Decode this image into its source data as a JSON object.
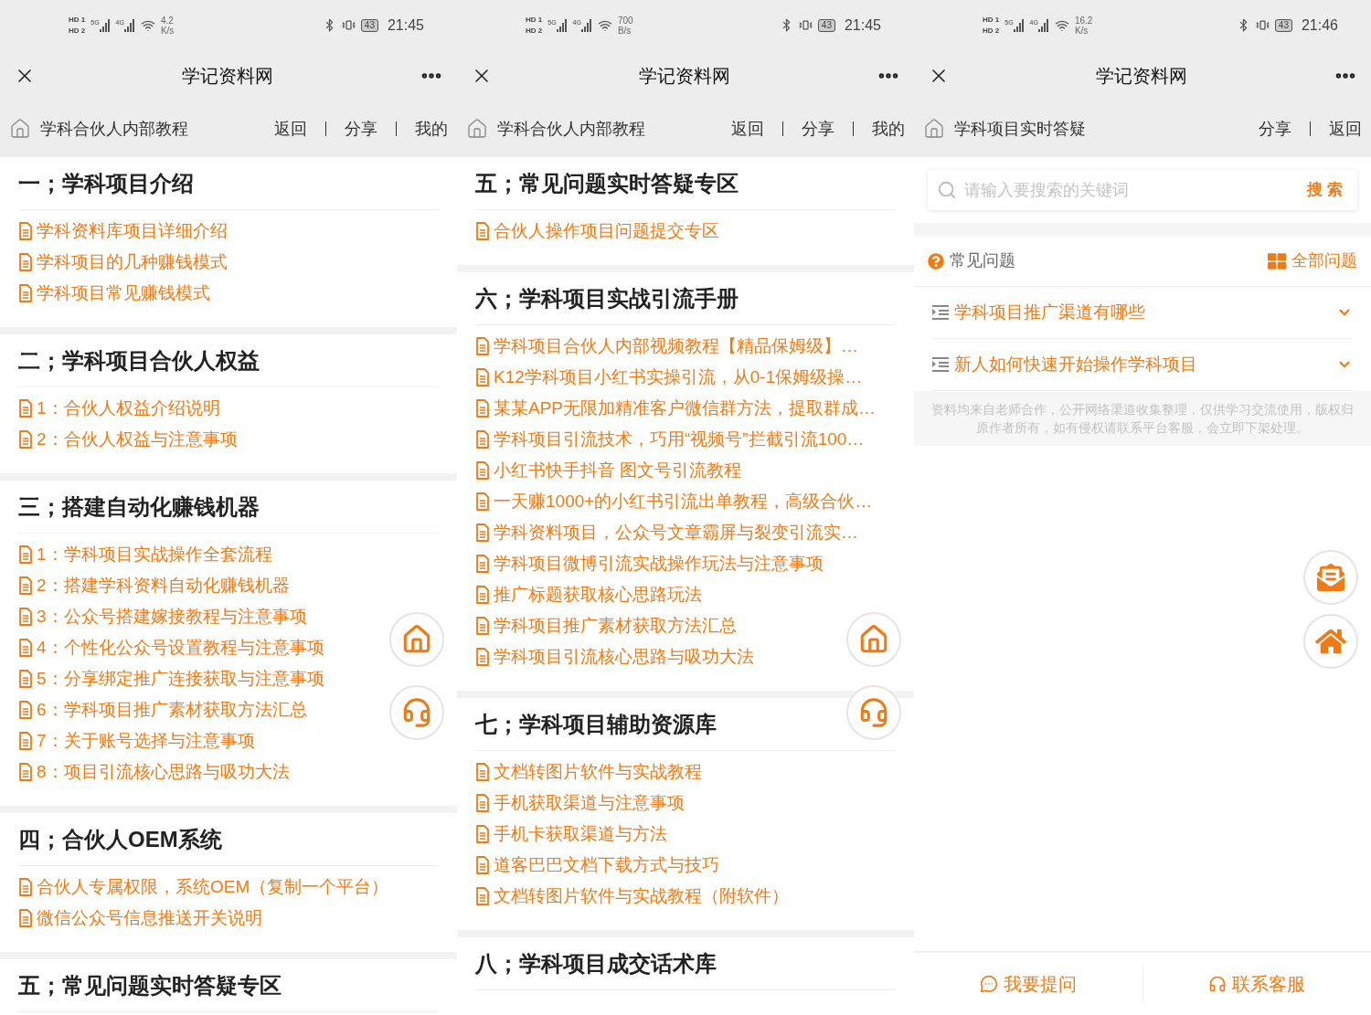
{
  "panels": [
    {
      "kind": "catalog",
      "status_bar": {
        "sims": [
          {
            "label": "HD",
            "slot": "1"
          },
          {
            "label": "HD",
            "slot": "2"
          }
        ],
        "networks": [
          "5G",
          "4G"
        ],
        "speed": "4.2",
        "speed_unit": "K/s",
        "battery": "43",
        "time": "21:45"
      },
      "title": "学记资料网",
      "nav": {
        "title": "学科合伙人内部教程",
        "links": [
          "返回",
          "分享",
          "我的"
        ]
      },
      "sections": [
        {
          "heading": "一；学科项目介绍",
          "items": [
            "学科资料库项目详细介绍",
            "学科项目的几种赚钱模式",
            "学科项目常见赚钱模式"
          ]
        },
        {
          "heading": "二；学科项目合伙人权益",
          "items": [
            "1：合伙人权益介绍说明",
            "2：合伙人权益与注意事项"
          ]
        },
        {
          "heading": "三；搭建自动化赚钱机器",
          "items": [
            "1：学科项目实战操作全套流程",
            "2：搭建学科资料自动化赚钱机器",
            "3：公众号搭建嫁接教程与注意事项",
            "4：个性化公众号设置教程与注意事项",
            "5：分享绑定推广连接获取与注意事项",
            "6：学科项目推广素材获取方法汇总",
            "7：关于账号选择与注意事项",
            "8：项目引流核心思路与吸功大法"
          ]
        },
        {
          "heading": "四；合伙人OEM系统",
          "items": [
            "合伙人专属权限，系统OEM（复制一个平台）",
            "微信公众号信息推送开关说明"
          ]
        },
        {
          "heading": "五；常见问题实时答疑专区"
        }
      ],
      "floating_buttons": [
        {
          "kind": "home"
        },
        {
          "kind": "support"
        }
      ]
    },
    {
      "kind": "catalog",
      "status_bar": {
        "sims": [
          {
            "label": "HD",
            "slot": "1"
          },
          {
            "label": "HD",
            "slot": "2"
          }
        ],
        "networks": [
          "5G",
          "4G"
        ],
        "speed": "700",
        "speed_unit": "B/s",
        "battery": "43",
        "time": "21:45"
      },
      "title": "学记资料网",
      "nav": {
        "title": "学科合伙人内部教程",
        "links": [
          "返回",
          "分享",
          "我的"
        ]
      },
      "sections": [
        {
          "heading": "五；常见问题实时答疑专区",
          "items": [
            "合伙人操作项目问题提交专区"
          ]
        },
        {
          "heading": "六；学科项目实战引流手册",
          "items": [
            "学科项目合伙人内部视频教程【精品保姆级】…",
            "K12学科项目小红书实操引流，从0-1保姆级操…",
            "某某APP无限加精准客户微信群方法，提取群成…",
            "学科项目引流技术，巧用“视频号”拦截引流100…",
            "小红书快手抖音 图文号引流教程",
            "一天赚1000+的小红书引流出单教程，高级合伙…",
            "学科资料项目，公众号文章霸屏与裂变引流实…",
            "学科项目微博引流实战操作玩法与注意事项",
            "推广标题获取核心思路玩法",
            "学科项目推广素材获取方法汇总",
            "学科项目引流核心思路与吸功大法"
          ]
        },
        {
          "heading": "七；学科项目辅助资源库",
          "items": [
            "文档转图片软件与实战教程",
            "手机获取渠道与注意事项",
            "手机卡获取渠道与方法",
            "道客巴巴文档下载方式与技巧",
            "文档转图片软件与实战教程（附软件）"
          ]
        },
        {
          "heading": "八；学科项目成交话术库"
        }
      ],
      "floating_buttons": [
        {
          "kind": "home"
        },
        {
          "kind": "support"
        }
      ]
    },
    {
      "kind": "faq",
      "status_bar": {
        "sims": [
          {
            "label": "HD",
            "slot": "1"
          },
          {
            "label": "HD",
            "slot": "2"
          }
        ],
        "networks": [
          "5G",
          "4G"
        ],
        "speed": "16.2",
        "speed_unit": "K/s",
        "battery": "43",
        "time": "21:46"
      },
      "title": "学记资料网",
      "nav": {
        "title": "学科项目实时答疑",
        "links": [
          "分享",
          "返回"
        ]
      },
      "search": {
        "placeholder": "请输入要搜索的关键词",
        "button": "搜 索"
      },
      "faq_header": {
        "title": "常见问题",
        "all_link": "全部问题"
      },
      "questions": [
        {
          "text": "学科项目推广渠道有哪些",
          "expanded": false
        },
        {
          "text": "新人如何快速开始操作学科项目",
          "expanded": false
        }
      ],
      "disclaimer": "资料均来自老师合作，公开网络渠道收集整理，仅供学习交流使用，版权归原作者所有，如有侵权请联系平台客服，会立即下架处理。",
      "floating_buttons": [
        {
          "kind": "mail"
        },
        {
          "kind": "home_filled"
        }
      ],
      "bottom_bar": [
        {
          "kind": "ask",
          "label": "我要提问"
        },
        {
          "kind": "service",
          "label": "联系客服"
        }
      ]
    }
  ]
}
